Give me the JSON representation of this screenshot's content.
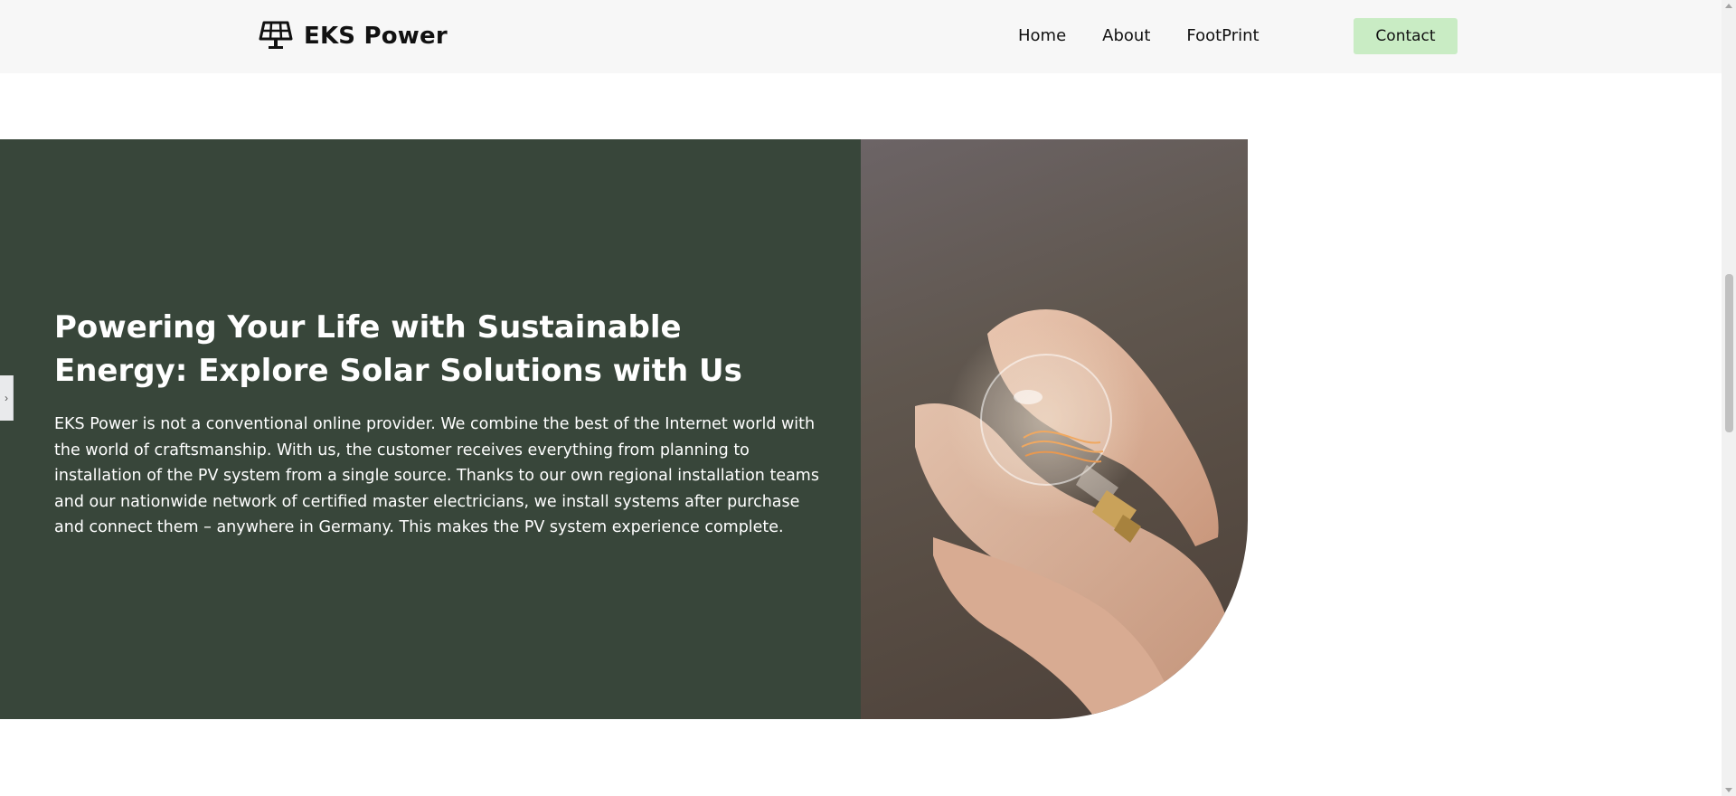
{
  "header": {
    "brand": "EKS Power",
    "logo_icon": "solar-panel-icon",
    "nav": [
      {
        "label": "Home"
      },
      {
        "label": "About"
      },
      {
        "label": "FootPrint"
      }
    ],
    "contact_label": "Contact"
  },
  "hero": {
    "title": "Powering Your Life with Sustainable Energy: Explore Solar Solutions with Us",
    "body": "EKS Power is not a conventional online provider. We combine the best of the Internet world with the world of craftsmanship. With us, the customer receives everything from planning to installation of the PV system from a single source. Thanks to our own regional installation teams and our nationwide network of certified master electricians, we install systems after purchase and connect them – anywhere in Germany. This makes the PV system experience complete.",
    "image_subject": "hands holding a light bulb"
  },
  "side_tab": {
    "icon": "chevron-right-icon",
    "glyph": "›"
  },
  "colors": {
    "header_bg": "#f7f7f7",
    "hero_green": "#38463a",
    "contact_button": "#c9ecc4",
    "text_white": "#ffffff"
  }
}
